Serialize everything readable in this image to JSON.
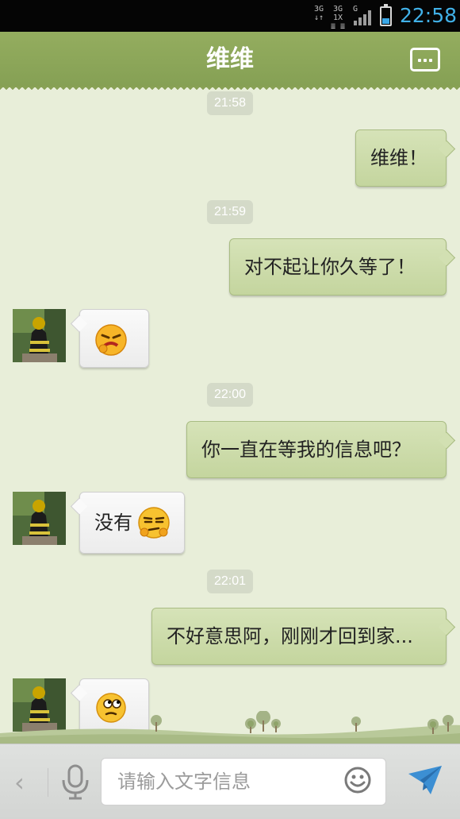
{
  "status_bar": {
    "net1_top": "3G",
    "net1_bottom": "↓↑",
    "net2_top": "3G 1X",
    "net2_bottom": "≣ ≣",
    "net3": "G",
    "time": "22:58",
    "battery_level": 0.35
  },
  "header": {
    "title": "维维",
    "menu_icon": "more-dots-icon"
  },
  "colors": {
    "header_green": "#8ba457",
    "chat_bg": "#e8eed9",
    "outgoing_bubble": "#cbd9a8",
    "incoming_bubble": "#f4f4f4",
    "time_accent": "#41b1e8"
  },
  "messages": [
    {
      "kind": "timestamp",
      "text": "21:58"
    },
    {
      "kind": "outgoing",
      "text": "维维！"
    },
    {
      "kind": "timestamp",
      "text": "21:59"
    },
    {
      "kind": "outgoing",
      "text": "对不起让你久等了！"
    },
    {
      "kind": "incoming",
      "text": "",
      "emoji": "angry-face-emoji"
    },
    {
      "kind": "timestamp",
      "text": "22:00"
    },
    {
      "kind": "outgoing",
      "text": "你一直在等我的信息吧？"
    },
    {
      "kind": "incoming",
      "text": "没有",
      "emoji": "annoyed-face-emoji"
    },
    {
      "kind": "timestamp",
      "text": "22:01"
    },
    {
      "kind": "outgoing",
      "text": "不好意思阿，刚刚才回到家..."
    },
    {
      "kind": "incoming",
      "text": "",
      "emoji": "pondering-face-emoji"
    }
  ],
  "input_bar": {
    "back_icon": "chevron-left-icon",
    "back_glyph": "‹",
    "mic_icon": "microphone-icon",
    "placeholder": "请输入文字信息",
    "emoji_icon": "smiley-icon",
    "send_icon": "send-arrow-icon"
  }
}
